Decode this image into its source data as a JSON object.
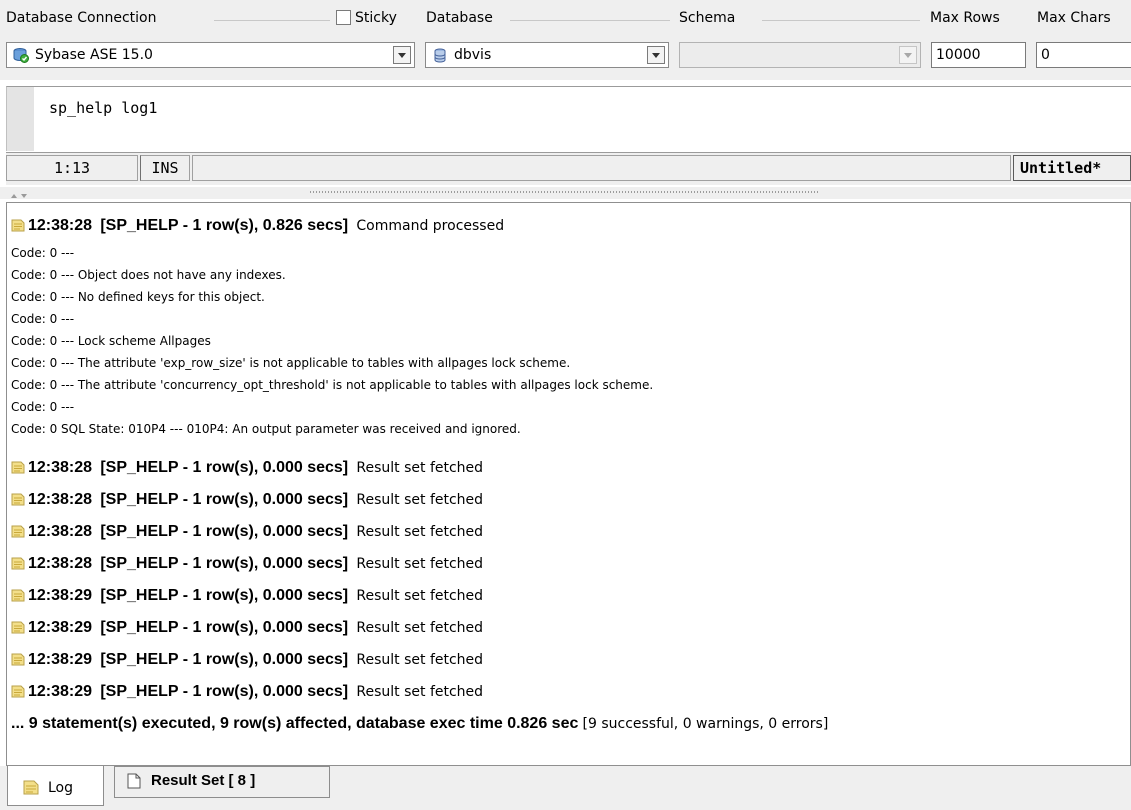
{
  "toolbar": {
    "db_connection_label": "Database Connection",
    "sticky_label": "Sticky",
    "database_label": "Database",
    "schema_label": "Schema",
    "max_rows_label": "Max Rows",
    "max_chars_label": "Max Chars",
    "connection_value": "Sybase ASE 15.0",
    "database_value": "dbvis",
    "schema_value": "",
    "max_rows_value": "10000",
    "max_chars_value": "0"
  },
  "editor": {
    "text": "sp_help log1"
  },
  "status": {
    "position": "1:13",
    "mode": "INS",
    "doc_title": "Untitled*"
  },
  "log": {
    "first": {
      "time": "12:38:28",
      "detail": "[SP_HELP - 1 row(s), 0.826 secs]",
      "message": "Command processed"
    },
    "code_lines": [
      "Code: 0 ---",
      "Code: 0 --- Object does not have any indexes.",
      "Code: 0 --- No defined keys for this object.",
      "Code: 0 ---",
      "Code: 0 --- Lock scheme Allpages",
      "Code: 0 --- The attribute 'exp_row_size' is not applicable to tables with allpages lock scheme.",
      "Code: 0 --- The attribute 'concurrency_opt_threshold' is not applicable to tables with allpages lock scheme.",
      "Code: 0 ---",
      "Code: 0 SQL State: 010P4 --- 010P4: An output parameter was received and ignored."
    ],
    "fetched": [
      {
        "time": "12:38:28",
        "detail": "[SP_HELP - 1 row(s), 0.000 secs]",
        "message": "Result set fetched"
      },
      {
        "time": "12:38:28",
        "detail": "[SP_HELP - 1 row(s), 0.000 secs]",
        "message": "Result set fetched"
      },
      {
        "time": "12:38:28",
        "detail": "[SP_HELP - 1 row(s), 0.000 secs]",
        "message": "Result set fetched"
      },
      {
        "time": "12:38:28",
        "detail": "[SP_HELP - 1 row(s), 0.000 secs]",
        "message": "Result set fetched"
      },
      {
        "time": "12:38:29",
        "detail": "[SP_HELP - 1 row(s), 0.000 secs]",
        "message": "Result set fetched"
      },
      {
        "time": "12:38:29",
        "detail": "[SP_HELP - 1 row(s), 0.000 secs]",
        "message": "Result set fetched"
      },
      {
        "time": "12:38:29",
        "detail": "[SP_HELP - 1 row(s), 0.000 secs]",
        "message": "Result set fetched"
      },
      {
        "time": "12:38:29",
        "detail": "[SP_HELP - 1 row(s), 0.000 secs]",
        "message": "Result set fetched"
      }
    ],
    "summary_bold": "... 9 statement(s) executed, 9 row(s) affected, database exec time 0.826 sec",
    "summary_plain": "[9 successful, 0 warnings, 0 errors]"
  },
  "tabs": {
    "log_label": "Log",
    "result_label": "Result Set [ 8 ]"
  },
  "icons": {
    "connection": "sybase-db-icon",
    "database": "database-icon",
    "log_entry": "note-icon",
    "log_tab": "note-icon",
    "result_tab": "document-icon"
  }
}
